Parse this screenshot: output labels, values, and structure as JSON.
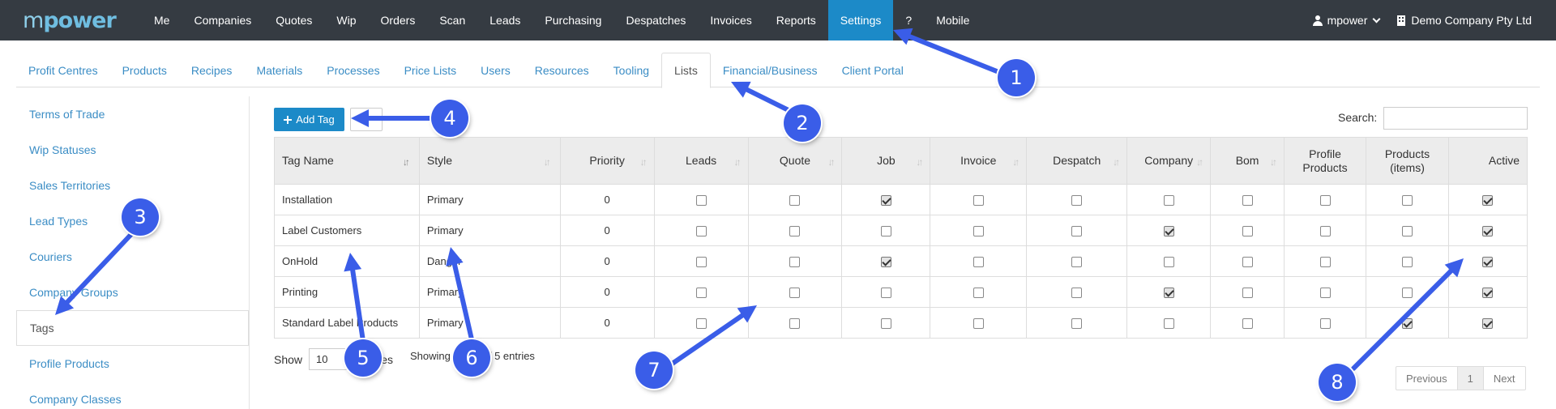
{
  "brand": {
    "logo_a": "m",
    "logo_b": "power"
  },
  "topnav": {
    "items": [
      "Me",
      "Companies",
      "Quotes",
      "Wip",
      "Orders",
      "Scan",
      "Leads",
      "Purchasing",
      "Despatches",
      "Invoices",
      "Reports",
      "Settings",
      "?",
      "Mobile"
    ],
    "active": "Settings",
    "user_label": "mpower",
    "company_label": "Demo Company Pty Ltd",
    "active_color": "#1c8ac8"
  },
  "subtabs": {
    "items": [
      "Profit Centres",
      "Products",
      "Recipes",
      "Materials",
      "Processes",
      "Price Lists",
      "Users",
      "Resources",
      "Tooling",
      "Lists",
      "Financial/Business",
      "Client Portal"
    ],
    "active": "Lists"
  },
  "sidemenu": {
    "items": [
      "Terms of Trade",
      "Wip Statuses",
      "Sales Territories",
      "Lead Types",
      "Couriers",
      "Company Groups",
      "Tags",
      "Profile Products",
      "Company Classes"
    ],
    "active": "Tags"
  },
  "toolbar": {
    "add_tag_label": "Add Tag"
  },
  "search": {
    "label": "Search:",
    "value": ""
  },
  "table": {
    "columns": [
      {
        "l1": "Tag Name",
        "l2": ""
      },
      {
        "l1": "Style",
        "l2": ""
      },
      {
        "l1": "Priority",
        "l2": ""
      },
      {
        "l1": "Leads",
        "l2": ""
      },
      {
        "l1": "Quote",
        "l2": ""
      },
      {
        "l1": "Job",
        "l2": ""
      },
      {
        "l1": "Invoice",
        "l2": ""
      },
      {
        "l1": "Despatch",
        "l2": ""
      },
      {
        "l1": "Company",
        "l2": ""
      },
      {
        "l1": "Bom",
        "l2": ""
      },
      {
        "l1": "Profile",
        "l2": "Products"
      },
      {
        "l1": "Products",
        "l2": "(items)"
      },
      {
        "l1": "Active",
        "l2": ""
      }
    ],
    "rows": [
      {
        "name": "Installation",
        "style": "Primary",
        "priority": "0",
        "flags": [
          false,
          false,
          true,
          false,
          false,
          false,
          false,
          false,
          false,
          true
        ]
      },
      {
        "name": "Label Customers",
        "style": "Primary",
        "priority": "0",
        "flags": [
          false,
          false,
          false,
          false,
          false,
          true,
          false,
          false,
          false,
          true
        ]
      },
      {
        "name": "OnHold",
        "style": "Danger",
        "priority": "0",
        "flags": [
          false,
          false,
          true,
          false,
          false,
          false,
          false,
          false,
          false,
          true
        ]
      },
      {
        "name": "Printing",
        "style": "Primary",
        "priority": "0",
        "flags": [
          false,
          false,
          false,
          false,
          false,
          true,
          false,
          false,
          false,
          true
        ]
      },
      {
        "name": "Standard Label Products",
        "style": "Primary",
        "priority": "0",
        "flags": [
          false,
          false,
          false,
          false,
          false,
          false,
          false,
          false,
          true,
          true
        ]
      }
    ]
  },
  "footer": {
    "show_label": "Show",
    "page_size": "10",
    "entries_label": "entries",
    "showing_text": "Showing 1 to 5 of 5 entries"
  },
  "pager": {
    "prev": "Previous",
    "current": "1",
    "next": "Next"
  },
  "annotations": {
    "color": "#3a5de8",
    "badges": [
      "1",
      "2",
      "3",
      "4",
      "5",
      "6",
      "7",
      "8"
    ]
  }
}
